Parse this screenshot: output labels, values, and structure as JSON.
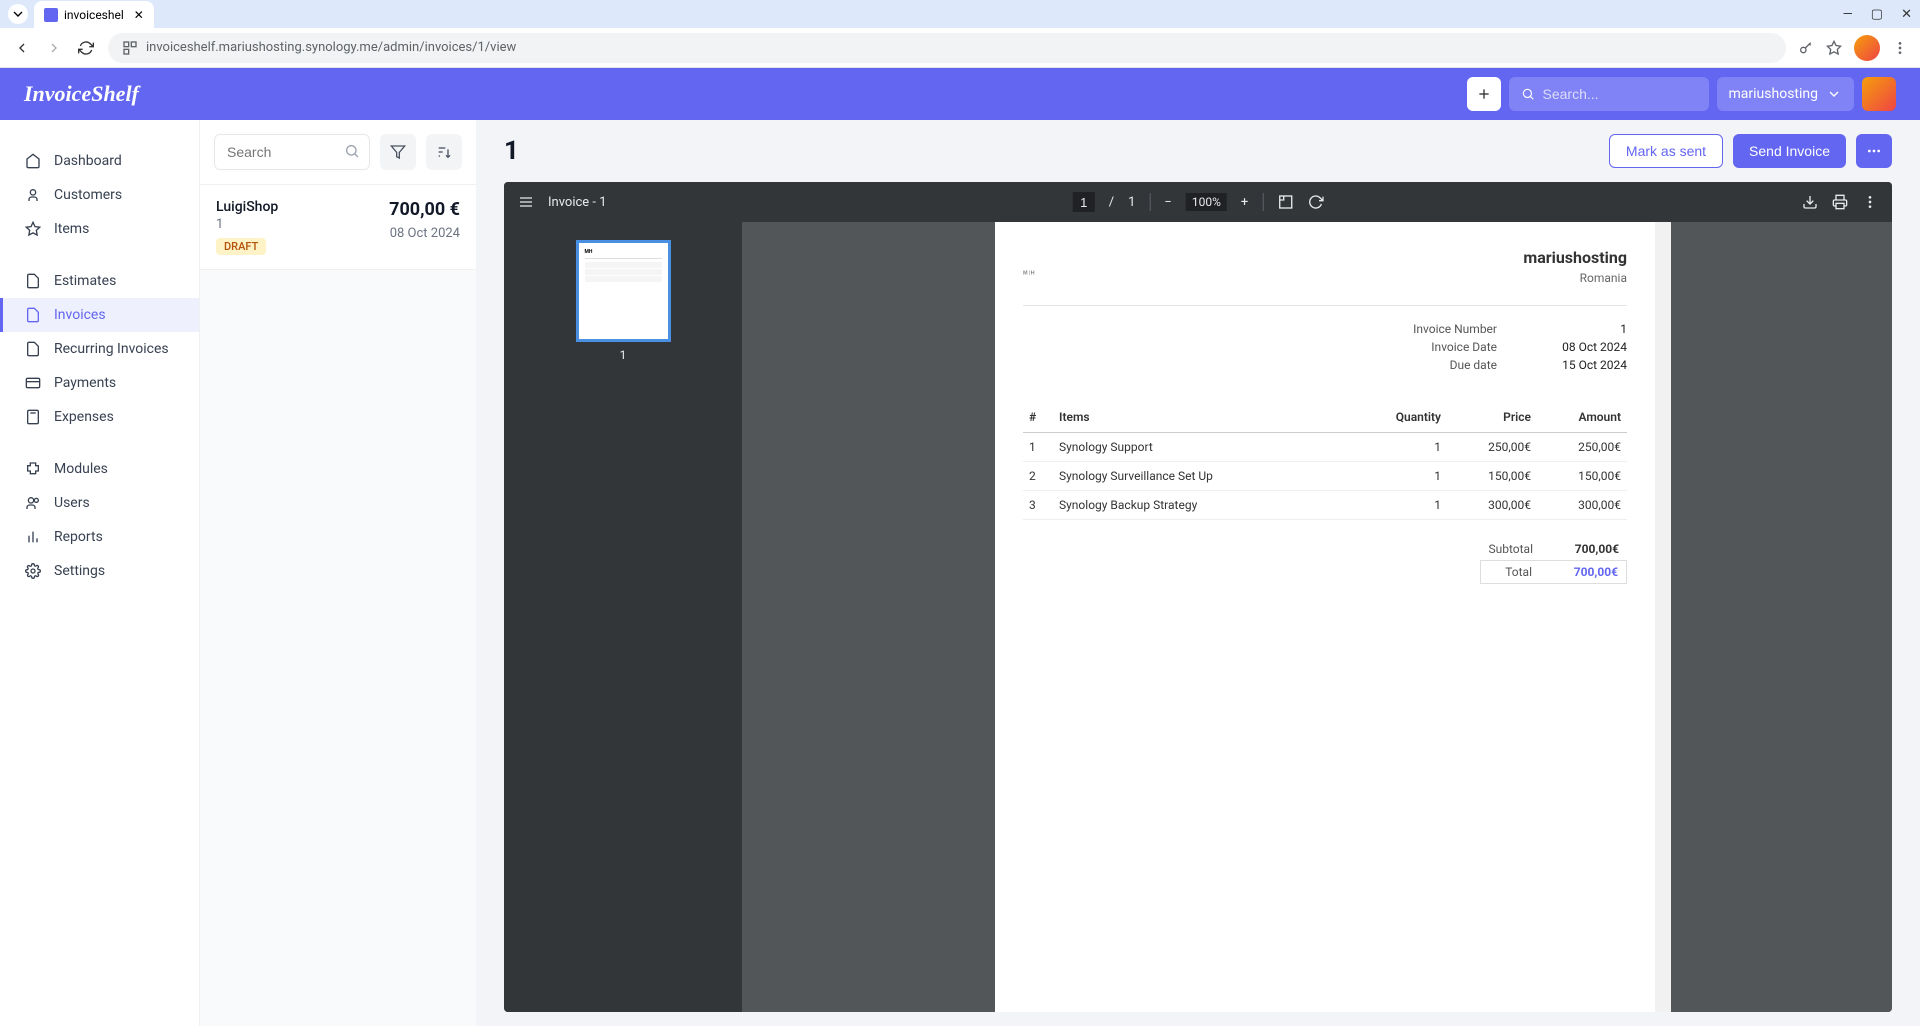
{
  "browser": {
    "tab_title": "invoiceshel",
    "url": "invoiceshelf.mariushosting.synology.me/admin/invoices/1/view"
  },
  "app": {
    "logo": "InvoiceShelf",
    "search_placeholder": "Search...",
    "user_name": "mariushosting"
  },
  "sidebar": {
    "group1": [
      {
        "label": "Dashboard",
        "icon": "home"
      },
      {
        "label": "Customers",
        "icon": "user"
      },
      {
        "label": "Items",
        "icon": "star"
      }
    ],
    "group2": [
      {
        "label": "Estimates",
        "icon": "file"
      },
      {
        "label": "Invoices",
        "icon": "file",
        "active": true
      },
      {
        "label": "Recurring Invoices",
        "icon": "file"
      },
      {
        "label": "Payments",
        "icon": "card"
      },
      {
        "label": "Expenses",
        "icon": "calc"
      }
    ],
    "group3": [
      {
        "label": "Modules",
        "icon": "puzzle"
      },
      {
        "label": "Users",
        "icon": "users"
      },
      {
        "label": "Reports",
        "icon": "chart"
      },
      {
        "label": "Settings",
        "icon": "gear"
      }
    ]
  },
  "list": {
    "search_placeholder": "Search",
    "item": {
      "customer": "LuigiShop",
      "number": "1",
      "amount": "700,00 €",
      "date": "08 Oct 2024",
      "status": "DRAFT"
    }
  },
  "content": {
    "title": "1",
    "mark_as_sent": "Mark as sent",
    "send_invoice": "Send Invoice"
  },
  "pdf": {
    "doc_title": "Invoice - 1",
    "page_current": "1",
    "page_total": "1",
    "zoom": "100%",
    "thumb_label": "1"
  },
  "invoice": {
    "logo_text": "M|H",
    "company": "mariushosting",
    "location": "Romania",
    "meta": {
      "number_label": "Invoice Number",
      "number": "1",
      "date_label": "Invoice Date",
      "date": "08 Oct 2024",
      "due_label": "Due date",
      "due": "15 Oct 2024"
    },
    "columns": {
      "idx": "#",
      "items": "Items",
      "qty": "Quantity",
      "price": "Price",
      "amount": "Amount"
    },
    "rows": [
      {
        "idx": "1",
        "name": "Synology Support",
        "qty": "1",
        "price": "250,00€",
        "amount": "250,00€"
      },
      {
        "idx": "2",
        "name": "Synology Surveillance Set Up",
        "qty": "1",
        "price": "150,00€",
        "amount": "150,00€"
      },
      {
        "idx": "3",
        "name": "Synology Backup Strategy",
        "qty": "1",
        "price": "300,00€",
        "amount": "300,00€"
      }
    ],
    "subtotal_label": "Subtotal",
    "subtotal": "700,00€",
    "total_label": "Total",
    "total": "700,00€"
  }
}
